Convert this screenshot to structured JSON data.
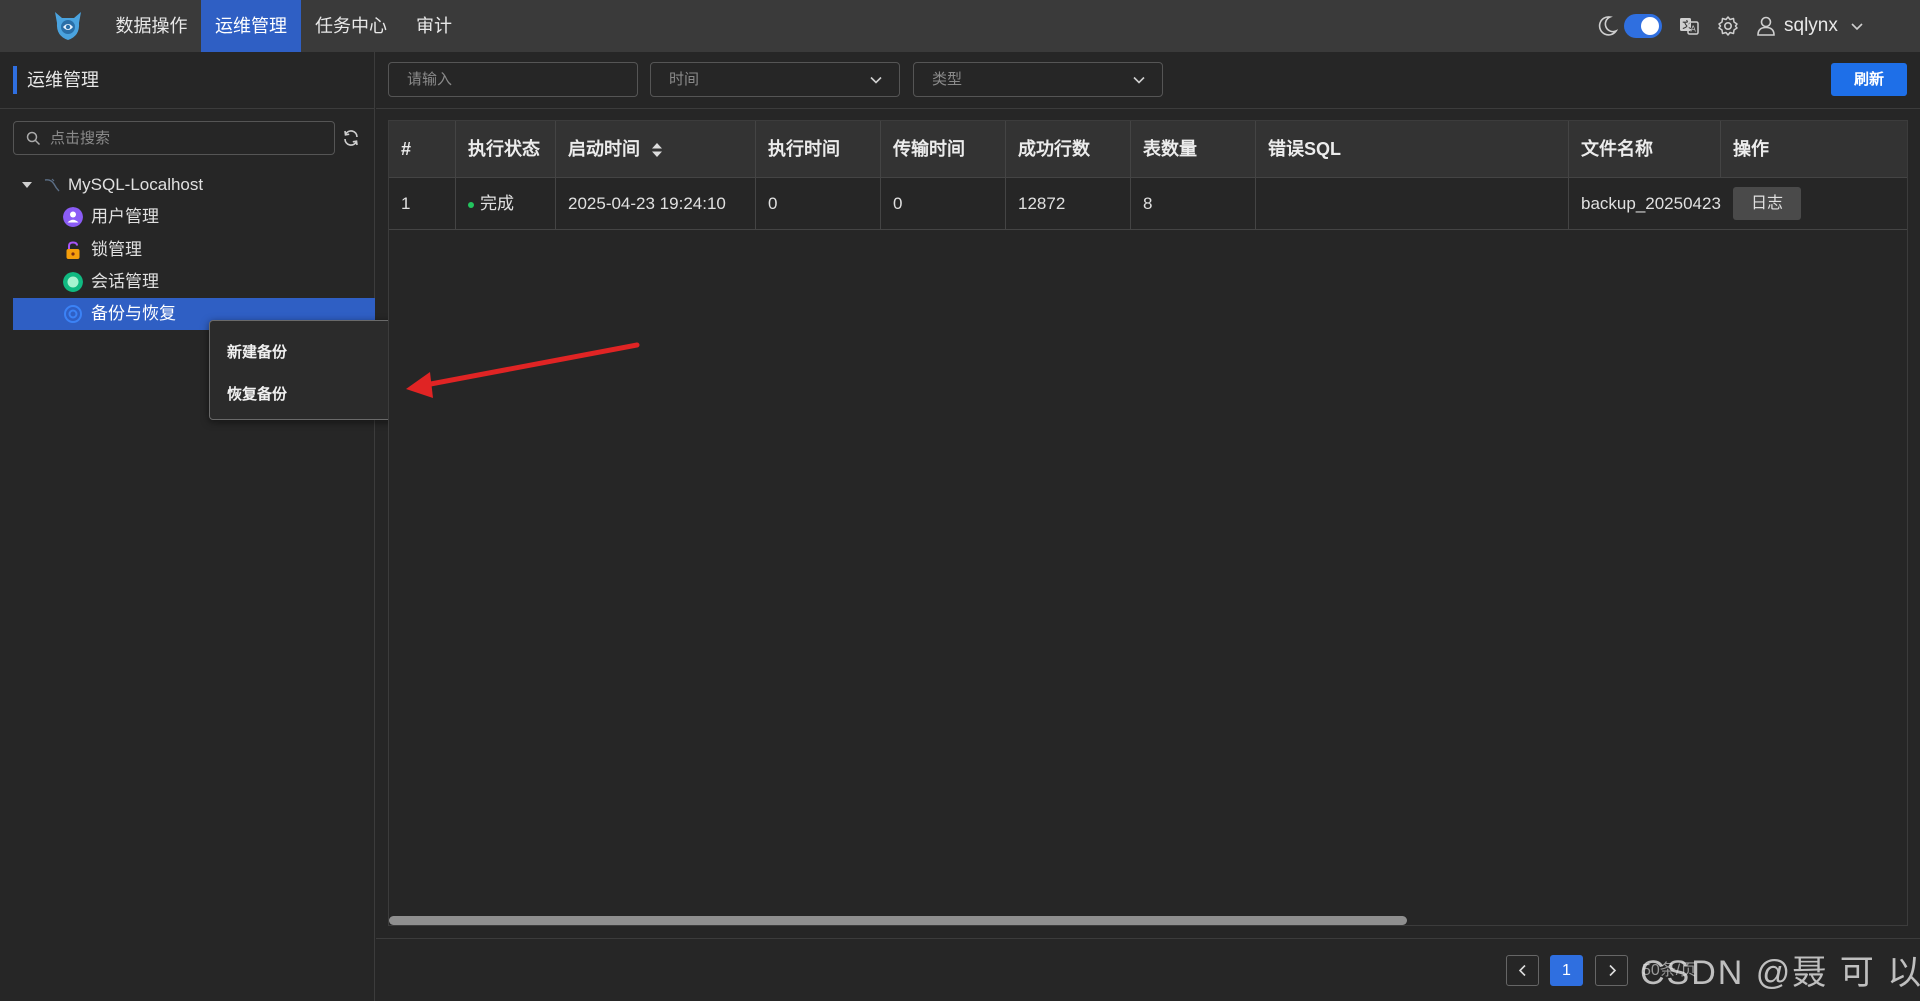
{
  "topbar": {
    "nav": [
      "数据操作",
      "运维管理",
      "任务中心",
      "审计"
    ],
    "active_index": 1,
    "user": "sqlynx"
  },
  "sidebar": {
    "title": "运维管理",
    "search_placeholder": "点击搜索",
    "connection": "MySQL-Localhost",
    "items": [
      {
        "label": "用户管理",
        "icon": "user-admin-icon",
        "color": "#8b5cf6"
      },
      {
        "label": "锁管理",
        "icon": "lock-icon",
        "color": "#a855f7"
      },
      {
        "label": "会话管理",
        "icon": "session-icon",
        "color": "#10b981"
      },
      {
        "label": "备份与恢复",
        "icon": "backup-icon",
        "color": "#3b82f6"
      }
    ],
    "selected_index": 3
  },
  "context_menu": {
    "items": [
      "新建备份",
      "恢复备份"
    ]
  },
  "filters": {
    "input_placeholder": "请输入",
    "time_placeholder": "时间",
    "type_placeholder": "类型",
    "refresh_label": "刷新"
  },
  "table": {
    "columns": [
      "#",
      "执行状态",
      "启动时间",
      "执行时间",
      "传输时间",
      "成功行数",
      "表数量",
      "错误SQL",
      "文件名称",
      "操作"
    ],
    "rows": [
      {
        "index": "1",
        "status": "完成",
        "start_time": "2025-04-23 19:24:10",
        "exec_time": "0",
        "transfer_time": "0",
        "success_rows": "12872",
        "table_count": "8",
        "error_sql": "",
        "file_name": "backup_20250423",
        "action": "日志"
      }
    ]
  },
  "pagination": {
    "current_page": "1",
    "page_size_label": "50条/页"
  },
  "watermark": "CSDN @聂 可 以",
  "colors": {
    "accent": "#2f5fc4",
    "primary_button": "#1e6fe8",
    "status_ok": "#22c55e",
    "annotation_arrow": "#e02424"
  }
}
